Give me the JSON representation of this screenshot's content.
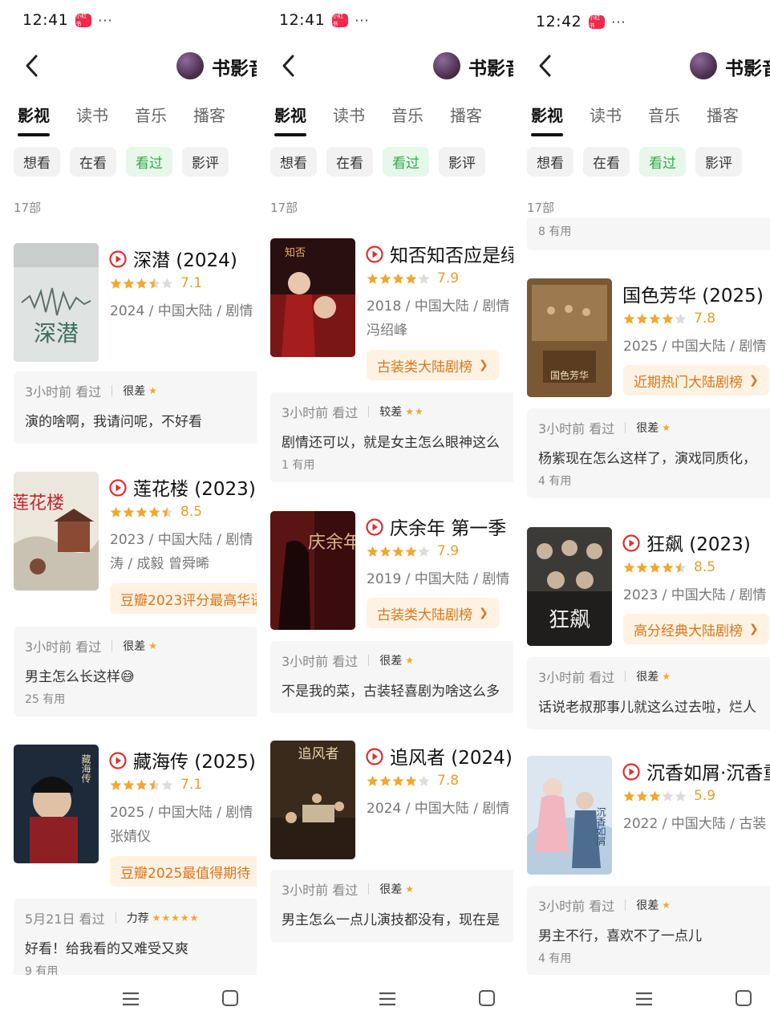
{
  "status": {
    "panels": [
      {
        "time": "12:41",
        "app_badge": "小红书",
        "more": "···"
      },
      {
        "time": "12:41",
        "app_badge": "小红书",
        "more": "···"
      },
      {
        "time": "12:42",
        "app_badge": "小红书",
        "more": "···"
      }
    ]
  },
  "header": {
    "title": "书影音"
  },
  "tabs": [
    "影视",
    "读书",
    "音乐",
    "播客"
  ],
  "filters": [
    "想看",
    "在看",
    "看过",
    "影评"
  ],
  "count": "17部",
  "colors": {
    "accent_green": "#2fa84f",
    "star": "#f2a72e",
    "rank_tag": "#d9761a",
    "play_icon": "#e02e2e"
  },
  "panel0": {
    "items": [
      {
        "title": "深潜 (2024)",
        "stars": 3.5,
        "rating": "7.1",
        "meta": "2024 / 中国大陆 / 剧情",
        "meta2": "",
        "tag": "",
        "review": {
          "when": "3小时前 看过",
          "level": "很差",
          "stars": "★",
          "text": "演的啥啊，我请问呢，不好看",
          "useful": ""
        }
      },
      {
        "title": "莲花楼 (2023)",
        "stars": 4.5,
        "rating": "8.5",
        "meta": "2023 / 中国大陆 / 剧情",
        "meta2": "涛 / 成毅 曾舜晞",
        "tag": "豆瓣2023评分最高华语",
        "review": {
          "when": "3小时前 看过",
          "level": "很差",
          "stars": "★",
          "text": "男主怎么长这样😅",
          "useful": "25 有用"
        }
      },
      {
        "title": "藏海传 (2025)",
        "stars": 3.5,
        "rating": "7.1",
        "meta": "2025 / 中国大陆 / 剧情",
        "meta2": "张婧仪",
        "tag": "豆瓣2025最值得期待",
        "review": {
          "when": "5月21日 看过",
          "level": "力荐",
          "stars": "★★★★★",
          "text": "好看！给我看的又难受又爽",
          "useful": "9 有用"
        }
      }
    ]
  },
  "panel1": {
    "items": [
      {
        "title": "知否知否应是绿",
        "stars": 4,
        "rating": "7.9",
        "meta": "2018 / 中国大陆 / 剧情",
        "meta2": "冯绍峰",
        "tag": "古装类大陆剧榜",
        "review": {
          "when": "3小时前 看过",
          "level": "较差",
          "stars": "★★",
          "text": "剧情还可以，就是女主怎么眼神这么",
          "useful": "1 有用"
        }
      },
      {
        "title": "庆余年 第一季",
        "stars": 4,
        "rating": "7.9",
        "meta": "2019 / 中国大陆 / 剧情",
        "meta2": "",
        "tag": "古装类大陆剧榜",
        "review": {
          "when": "3小时前 看过",
          "level": "很差",
          "stars": "★",
          "text": "不是我的菜，古装轻喜剧为啥这么多",
          "useful": ""
        }
      },
      {
        "title": "追风者 (2024)",
        "stars": 4,
        "rating": "7.8",
        "meta": "2024 / 中国大陆 / 剧情",
        "meta2": "",
        "tag": "",
        "review": {
          "when": "3小时前 看过",
          "level": "很差",
          "stars": "★",
          "text": "男主怎么一点儿演技都没有，现在是",
          "useful": ""
        }
      }
    ]
  },
  "panel2": {
    "prev_useful": "8 有用",
    "items": [
      {
        "title": "国色芳华 (2025)",
        "stars": 4,
        "rating": "7.8",
        "meta": "2025 / 中国大陆 / 剧情",
        "meta2": "",
        "tag": "近期热门大陆剧榜",
        "review": {
          "when": "3小时前 看过",
          "level": "很差",
          "stars": "★",
          "text": "杨紫现在怎么这样了，演戏同质化，",
          "useful": "4 有用"
        }
      },
      {
        "title": "狂飙 (2023)",
        "stars": 4.5,
        "rating": "8.5",
        "meta": "2023 / 中国大陆 / 剧情",
        "meta2": "",
        "tag": "高分经典大陆剧榜",
        "review": {
          "when": "3小时前 看过",
          "level": "很差",
          "stars": "★",
          "text": "话说老叔那事儿就这么过去啦，烂人",
          "useful": ""
        }
      },
      {
        "title": "沉香如屑·沉香重华",
        "stars": 3,
        "rating": "5.9",
        "meta": "2022 / 中国大陆 / 古装",
        "meta2": "",
        "tag": "",
        "review": {
          "when": "3小时前 看过",
          "level": "很差",
          "stars": "★",
          "text": "男主不行，喜欢不了一点儿",
          "useful": "4 有用"
        }
      }
    ]
  },
  "posters": {
    "p0_0": "深潜",
    "p0_1": "莲花楼",
    "p0_2": "藏海传",
    "p1_0": "知否",
    "p1_1": "庆余年",
    "p1_2": "追风者",
    "p2_0": "国色芳华",
    "p2_1": "狂飙",
    "p2_2": "沉香如屑"
  }
}
